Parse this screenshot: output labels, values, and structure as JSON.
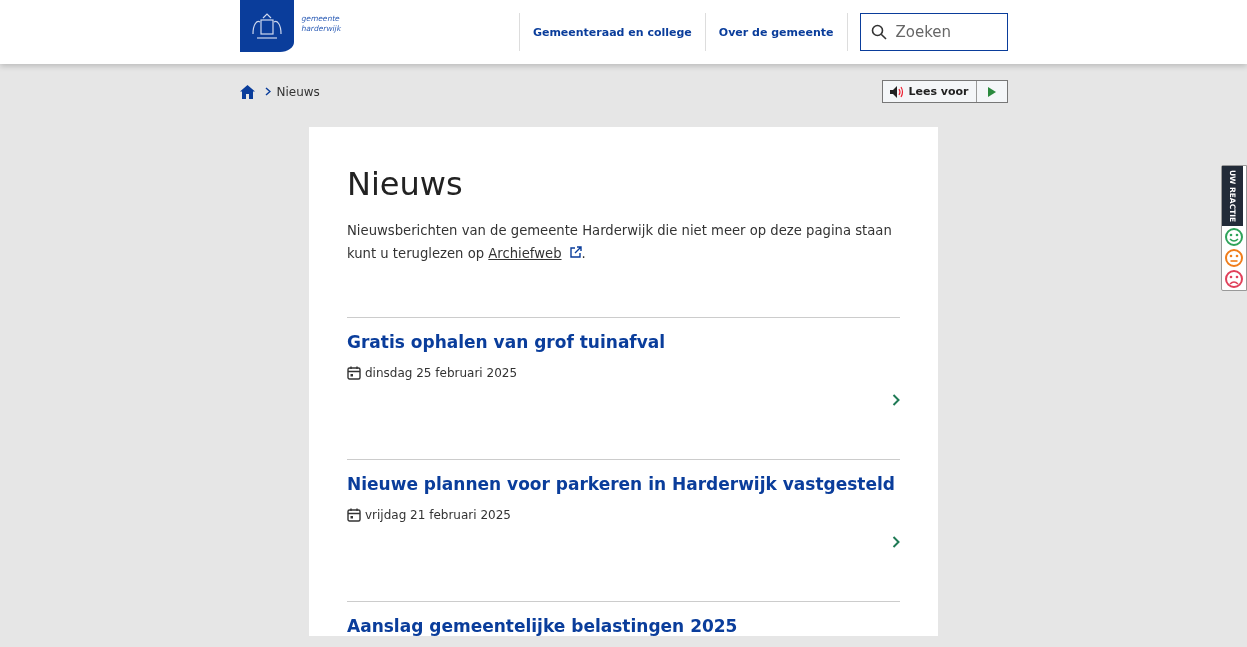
{
  "logo": {
    "line1": "gemeente",
    "line2": "harderwijk"
  },
  "nav": [
    {
      "label": "Gemeenteraad en college"
    },
    {
      "label": "Over de gemeente"
    }
  ],
  "search": {
    "placeholder": "Zoeken"
  },
  "breadcrumb": [
    "Nieuws"
  ],
  "read_aloud": {
    "label": "Lees voor"
  },
  "feedback": {
    "label": "UW REACTIE"
  },
  "page": {
    "title": "Nieuws",
    "intro": "Nieuwsberichten van de gemeente Harderwijk die niet meer op deze pagina staan kunt u teruglezen op ",
    "link": "Archiefweb",
    "after": "."
  },
  "news": [
    {
      "title": "Gratis ophalen van grof tuinafval",
      "date": "dinsdag 25 februari 2025"
    },
    {
      "title": "Nieuwe plannen voor parkeren in Harderwijk vastgesteld",
      "date": "vrijdag 21 februari 2025"
    },
    {
      "title": "Aanslag gemeentelijke belastingen 2025"
    }
  ]
}
